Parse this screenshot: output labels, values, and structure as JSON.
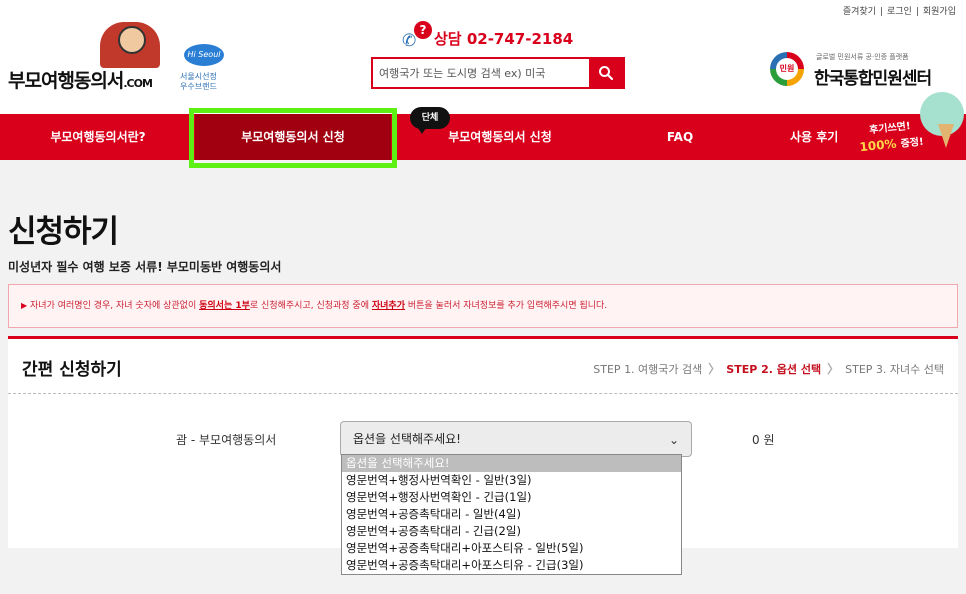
{
  "header": {
    "top_links": [
      "즐겨찾기",
      "로그인",
      "회원가입"
    ],
    "top_sep": "|",
    "logo_main": "부모여행동의서",
    "logo_suffix": ".COM",
    "seoul_badge": "Hi Seoul",
    "seoul_line1": "서울시선정",
    "seoul_line2": "우수브랜드",
    "phone_icon_glyph": "?",
    "phone": "상담 02-747-2184",
    "search_placeholder": "여행국가 또는 도시명 검색 ex) 미국",
    "kcenter_icon": "민원",
    "kcenter_sub": "글로벌 민원서류 공·인증 플랫폼",
    "kcenter_main": "한국통합민원센터"
  },
  "nav": {
    "items": [
      "부모여행동의서란?",
      "부모여행동의서 신청",
      "부모여행동의서 신청",
      "FAQ",
      "사용 후기"
    ],
    "group_badge": "단체",
    "review_badge_l1": "후기쓰면!",
    "review_badge_l2": "100%",
    "review_badge_l3": "증정!"
  },
  "page": {
    "title": "신청하기",
    "subtitle": "미성년자 필수 여행 보증 서류! 부모미동반 여행동의서",
    "notice_marker": "▶",
    "notice_part1": "자녀가 여러명인 경우, 자녀 숫자에 상관없이 ",
    "notice_u1": "동의서는 1부",
    "notice_part2": "로 신청해주시고, 신청과정 중에 ",
    "notice_u2": "자녀추가",
    "notice_part3": " 버튼을 눌러서 자녀정보를 추가 입력해주시면 됩니다."
  },
  "panel": {
    "title": "간편 신청하기",
    "steps": [
      "STEP 1. 여행국가 검색",
      "STEP 2. 옵션 선택",
      "STEP 3. 자녀수 선택"
    ],
    "step_arrow": "〉",
    "label": "괌 - 부모여행동의서",
    "select_value": "옵션을 선택해주세요!",
    "price": "0 원"
  },
  "dropdown": {
    "options": [
      "옵션을 선택해주세요!",
      "영문번역+행정사번역확인 - 일반(3일)",
      "영문번역+행정사번역확인 - 긴급(1일)",
      "영문번역+공증촉탁대리 - 일반(4일)",
      "영문번역+공증촉탁대리 - 긴급(2일)",
      "영문번역+공증촉탁대리+아포스티유 - 일반(5일)",
      "영문번역+공증촉탁대리+아포스티유 - 긴급(3일)"
    ],
    "highlighted_index": 0
  },
  "colors": {
    "brand_red": "#d8001b",
    "active_nav": "#a0000f",
    "highlight_box": "#5cf014"
  }
}
